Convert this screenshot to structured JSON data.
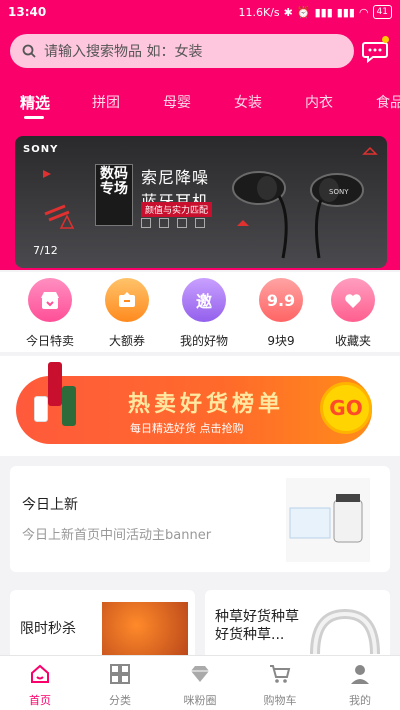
{
  "status_bar": {
    "time": "13:40",
    "speed": "11.6K/s",
    "battery": "41"
  },
  "search": {
    "placeholder": "请输入搜索物品 如：女装"
  },
  "tabs": [
    "精选",
    "拼团",
    "母婴",
    "女装",
    "内衣",
    "食品"
  ],
  "active_tab": "精选",
  "banner": {
    "brand": "SONY",
    "badge": "数码专场",
    "title_line1": "索尼降噪",
    "title_line2": "蓝牙耳机",
    "subtitle": "颜值与实力匹配",
    "counter": "7/12"
  },
  "quick_entries": [
    {
      "label": "今日特卖",
      "icon": "shop-icon",
      "color": "#ff5fa2"
    },
    {
      "label": "大额券",
      "icon": "coupon-icon",
      "color": "#ff9f2e"
    },
    {
      "label": "我的好物",
      "icon": "邀",
      "color": "#a06cf0"
    },
    {
      "label": "9块9",
      "icon": "9.9",
      "color": "#ff7a7a"
    },
    {
      "label": "收藏夹",
      "icon": "heart-icon",
      "color": "#ff5f8f"
    }
  ],
  "promo": {
    "title": "热卖好货榜单",
    "subtitle": "每日精选好货 点击抢购",
    "go": "GO"
  },
  "new_card": {
    "title": "今日上新",
    "subtitle": "今日上新首页中间活动主banner"
  },
  "cards": [
    {
      "title": "限时秒杀"
    },
    {
      "title": "种草好货种草好货种草..."
    }
  ],
  "bottom_nav": [
    {
      "label": "首页",
      "icon": "home-icon"
    },
    {
      "label": "分类",
      "icon": "grid-icon"
    },
    {
      "label": "咪粉圈",
      "icon": "diamond-icon"
    },
    {
      "label": "购物车",
      "icon": "cart-icon"
    },
    {
      "label": "我的",
      "icon": "person-icon"
    }
  ],
  "colors": {
    "accent": "#f9006b",
    "promo": "#ff5a3c"
  }
}
